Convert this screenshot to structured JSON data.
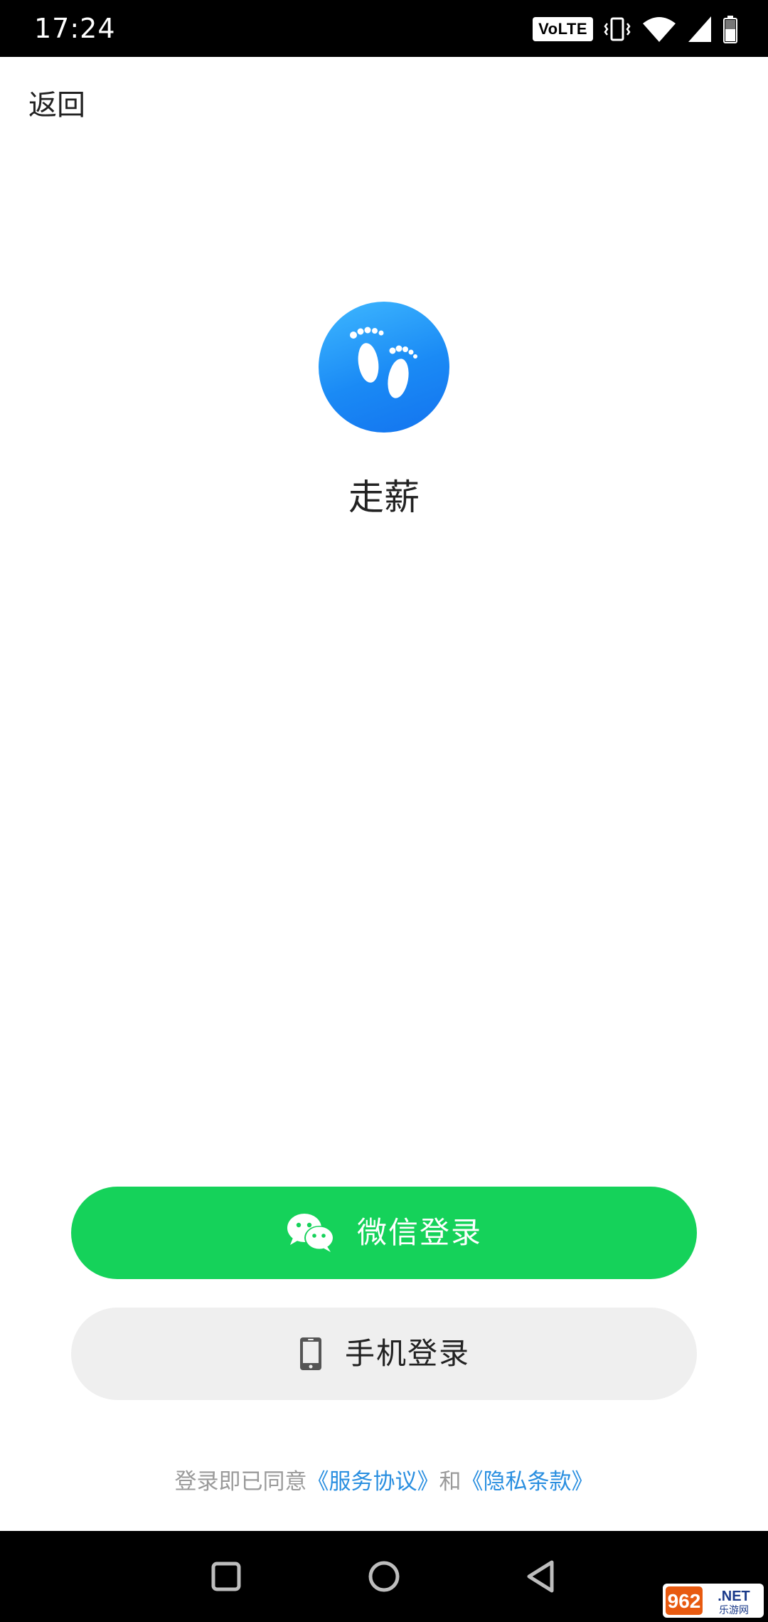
{
  "status_bar": {
    "time": "17:24",
    "volte": "VoLTE",
    "icons": [
      "volte-icon",
      "vibrate-icon",
      "wifi-icon",
      "signal-icon",
      "battery-icon"
    ]
  },
  "header": {
    "back_label": "返回"
  },
  "app": {
    "name": "走薪",
    "logo_icon": "footprints-icon",
    "brand_color": "#1a8af5"
  },
  "login": {
    "wechat_label": "微信登录",
    "wechat_icon": "wechat-icon",
    "wechat_color": "#15d25a",
    "phone_label": "手机登录",
    "phone_icon": "phone-icon",
    "phone_bg": "#efefef"
  },
  "agreement": {
    "prefix": "登录即已同意",
    "service_link": "《服务协议》",
    "conjunction": "和",
    "privacy_link": "《隐私条款》",
    "link_color": "#2a8fe0"
  },
  "nav_bar": {
    "icons": [
      "recent-apps-icon",
      "home-icon",
      "back-icon"
    ]
  },
  "watermark": {
    "text": "962.NET",
    "subtext": "乐游网"
  }
}
